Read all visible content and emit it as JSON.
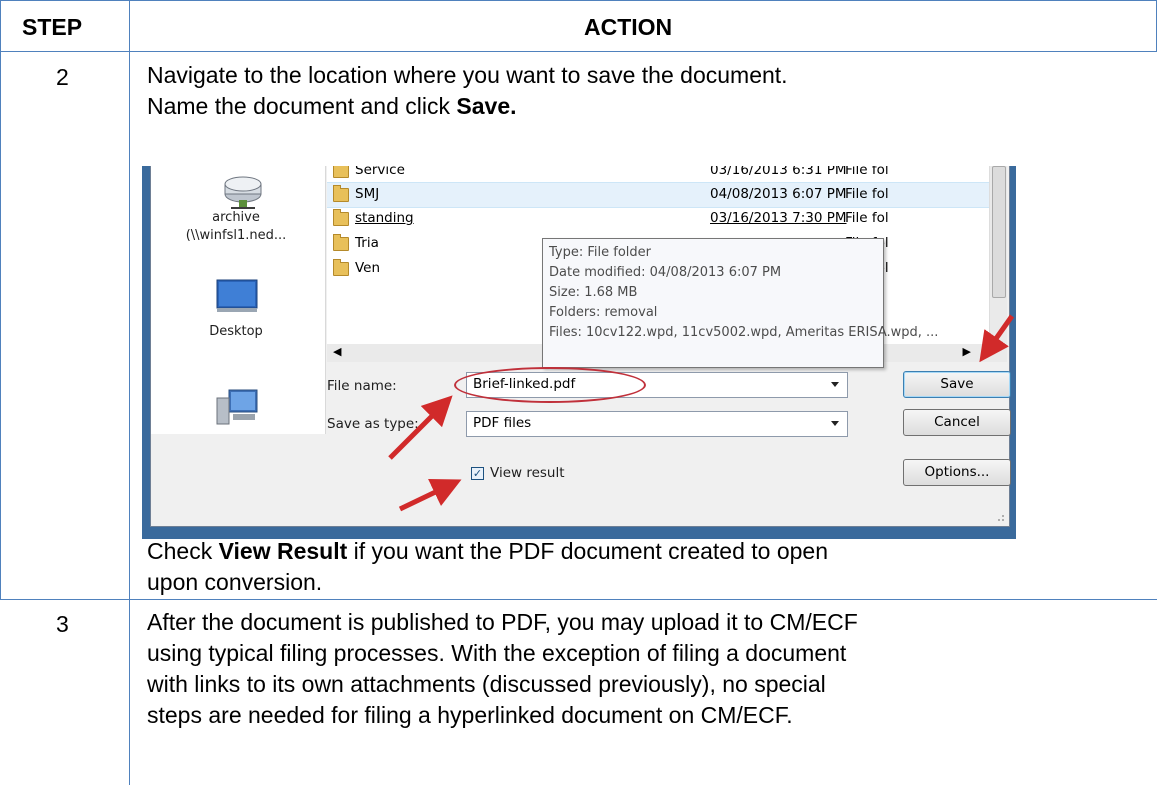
{
  "table": {
    "header_step": "STEP",
    "header_action": "ACTION",
    "row2_step": "2",
    "row2_line1": "Navigate to the location where you want to save the document.",
    "row2_line2_pre": "Name the document and click ",
    "row2_line2_bold": "Save.",
    "row2_after_pre": "Check ",
    "row2_after_bold": "View Result",
    "row2_after_post": " if you want the PDF document created to open",
    "row2_after_line2": "upon conversion.",
    "row3_step": "3",
    "row3_lines": [
      "After the document is published to PDF, you may upload it to CM/ECF",
      "using typical filing processes.  With the exception of filing a document",
      "with links to its own attachments (discussed previously), no special",
      "steps are needed for filing a hyperlinked document on CM/ECF."
    ]
  },
  "dialog": {
    "places": [
      {
        "label": "archive",
        "icon": "network-drive-icon"
      },
      {
        "label": "(\\\\winfsl1.ned...",
        "icon": ""
      },
      {
        "label": "Desktop",
        "icon": "desktop-icon"
      },
      {
        "label": "",
        "icon": "computer-icon"
      }
    ],
    "files": [
      {
        "name": "Service",
        "date": "03/16/2013 6:31 PM",
        "type": "File fol"
      },
      {
        "name": "SMJ",
        "date": "04/08/2013 6:07 PM",
        "type": "File fol"
      },
      {
        "name": "standing",
        "date": "03/16/2013 7:30 PM",
        "type": "File fol"
      },
      {
        "name": "Tria",
        "date": "...",
        "type": "File fol"
      },
      {
        "name": "Ven",
        "date": "PM",
        "type": "File fol"
      }
    ],
    "tooltip": [
      "Type: File folder",
      "Date modified: 04/08/2013 6:07 PM",
      "Size: 1.68 MB",
      "Folders: removal",
      "Files: 10cv122.wpd, 11cv5002.wpd, Ameritas ERISA.wpd, ..."
    ],
    "file_name_label": "File name:",
    "file_name_value": "Brief-linked.pdf",
    "save_type_label": "Save as type:",
    "save_type_value": "PDF files",
    "view_result_label": "View result",
    "view_result_checked": true,
    "save_button": "Save",
    "cancel_button": "Cancel",
    "options_button": "Options...",
    "annotation_color": "#d12a2a"
  }
}
